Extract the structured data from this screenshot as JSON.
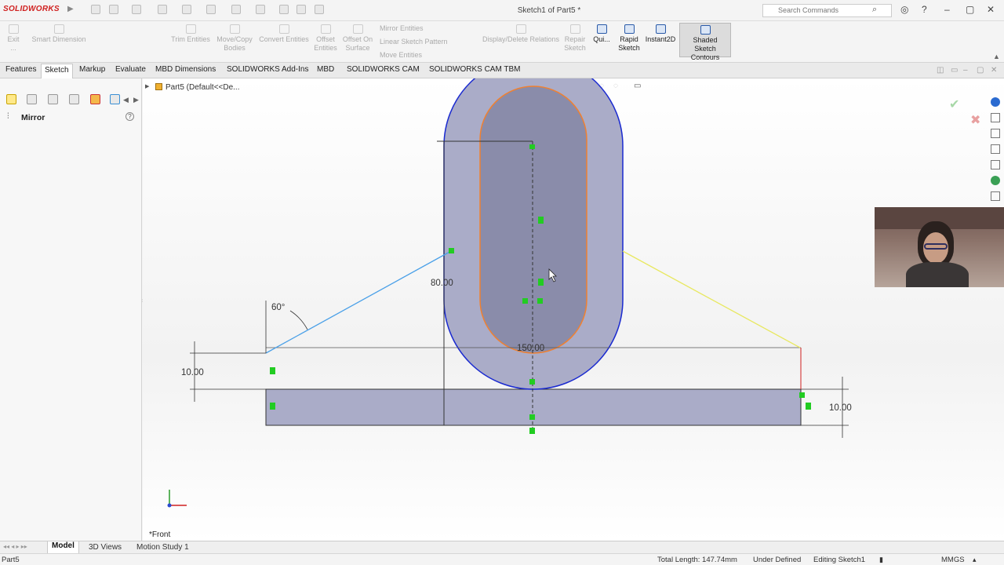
{
  "app": {
    "brand": "SOLIDWORKS",
    "doc_title": "Sketch1 of Part5 *",
    "search_placeholder": "Search Commands"
  },
  "ribbon": {
    "exit": "Exit ...",
    "smart_dimension": "Smart Dimension",
    "trim": "Trim Entities",
    "movecopy": "Move/Copy Bodies",
    "convert": "Convert Entities",
    "offset": "Offset Entities",
    "offset_surface": "Offset On Surface",
    "mirror_entities": "Mirror Entities",
    "linear_pattern": "Linear Sketch Pattern",
    "move_entities": "Move Entities",
    "display_relations": "Display/Delete Relations",
    "repair": "Repair Sketch",
    "quick": "Qui...",
    "rapid": "Rapid Sketch",
    "instant2d": "Instant2D",
    "shaded": "Shaded Sketch Contours"
  },
  "tabs": [
    "Features",
    "Sketch",
    "Markup",
    "Evaluate",
    "MBD Dimensions",
    "SOLIDWORKS Add-Ins",
    "MBD",
    "SOLIDWORKS CAM",
    "SOLIDWORKS CAM TBM"
  ],
  "left_panel": {
    "mirror_label": "Mirror",
    "help": "?"
  },
  "viewport": {
    "tree_label": "Part5 (Default<<De...",
    "view_name": "*Front",
    "dims": {
      "angle": "60°",
      "height_mid": "80.00",
      "width_center": "150.00",
      "left_thickness": "10.00",
      "right_thickness": "10.00"
    }
  },
  "bottom_tabs": [
    "Model",
    "3D Views",
    "Motion Study 1"
  ],
  "status": {
    "part": "Part5",
    "total_length": "Total Length: 147.74mm",
    "definition": "Under Defined",
    "editing": "Editing Sketch1",
    "units": "MMGS"
  },
  "colors": {
    "shape_fill": "#aaacc8",
    "slot_fill": "#8a8caa",
    "outline_blue": "#1a2ad0",
    "outline_orange": "#f08030",
    "line_cyan": "#4aa0e8",
    "line_yellow": "#e8e860",
    "point_green": "#22cc22"
  }
}
